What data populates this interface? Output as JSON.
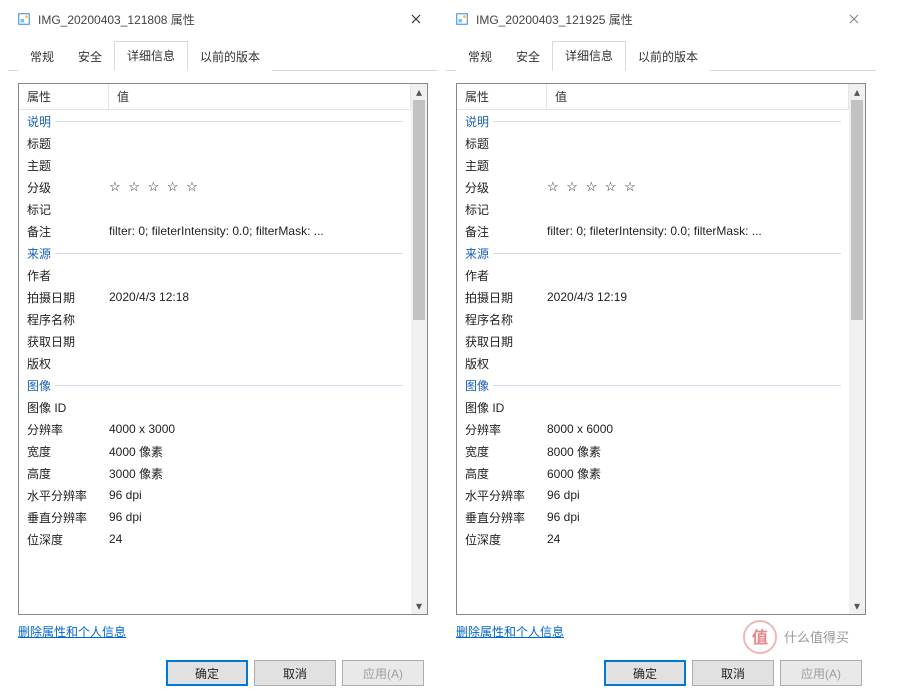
{
  "common": {
    "tabs": [
      "常规",
      "安全",
      "详细信息",
      "以前的版本"
    ],
    "active_tab_index": 2,
    "header": {
      "property": "属性",
      "value": "值"
    },
    "section_labels": {
      "description": "说明",
      "origin": "来源",
      "image": "图像"
    },
    "labels": {
      "title": "标题",
      "subject": "主题",
      "rating": "分级",
      "tags": "标记",
      "comments": "备注",
      "authors": "作者",
      "date_taken": "拍摄日期",
      "program_name": "程序名称",
      "date_acquired": "获取日期",
      "copyright": "版权",
      "image_id": "图像 ID",
      "dimensions": "分辨率",
      "width": "宽度",
      "height": "高度",
      "h_res": "水平分辨率",
      "v_res": "垂直分辨率",
      "bit_depth": "位深度"
    },
    "stars": "☆ ☆ ☆ ☆ ☆",
    "remove_link": "删除属性和个人信息",
    "buttons": {
      "ok": "确定",
      "cancel": "取消",
      "apply": "应用(A)"
    },
    "watermark": "什么值得买"
  },
  "left": {
    "window_title": "IMG_20200403_121808 属性",
    "values": {
      "comments": "filter: 0; fileterIntensity: 0.0; filterMask: ...",
      "date_taken": "2020/4/3 12:18",
      "dimensions": "4000 x 3000",
      "width": "4000 像素",
      "height": "3000 像素",
      "h_res": "96 dpi",
      "v_res": "96 dpi",
      "bit_depth": "24"
    }
  },
  "right": {
    "window_title": "IMG_20200403_121925 属性",
    "values": {
      "comments": "filter: 0; fileterIntensity: 0.0; filterMask: ...",
      "date_taken": "2020/4/3 12:19",
      "dimensions": "8000 x 6000",
      "width": "8000 像素",
      "height": "6000 像素",
      "h_res": "96 dpi",
      "v_res": "96 dpi",
      "bit_depth": "24"
    }
  }
}
